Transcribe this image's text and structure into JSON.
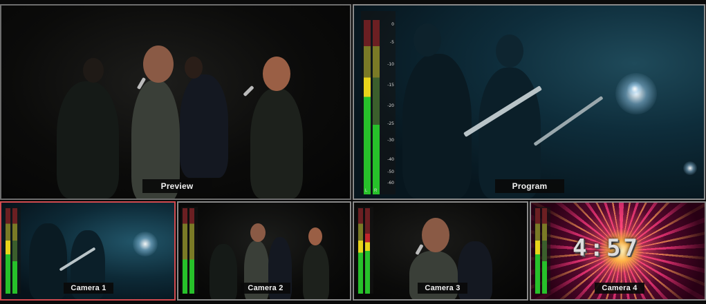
{
  "preview": {
    "label": "Preview"
  },
  "program": {
    "label": "Program",
    "meter": {
      "channels": [
        "L",
        "R"
      ],
      "scale": [
        "0",
        "-5",
        "-10",
        "-15",
        "-20",
        "-25",
        "-30",
        "-40",
        "-50",
        "-60"
      ]
    }
  },
  "cameras": [
    {
      "label": "Camera 1",
      "active": true
    },
    {
      "label": "Camera 2",
      "active": false
    },
    {
      "label": "Camera 3",
      "active": false
    },
    {
      "label": "Camera 4",
      "active": false,
      "countdown": "4:57"
    }
  ],
  "colors": {
    "active_border": "#d24a4f",
    "pane_border": "#8a8a8a",
    "meter_green": "#27c12a",
    "meter_yellow": "#e8d41a",
    "meter_red": "#c0262c"
  }
}
